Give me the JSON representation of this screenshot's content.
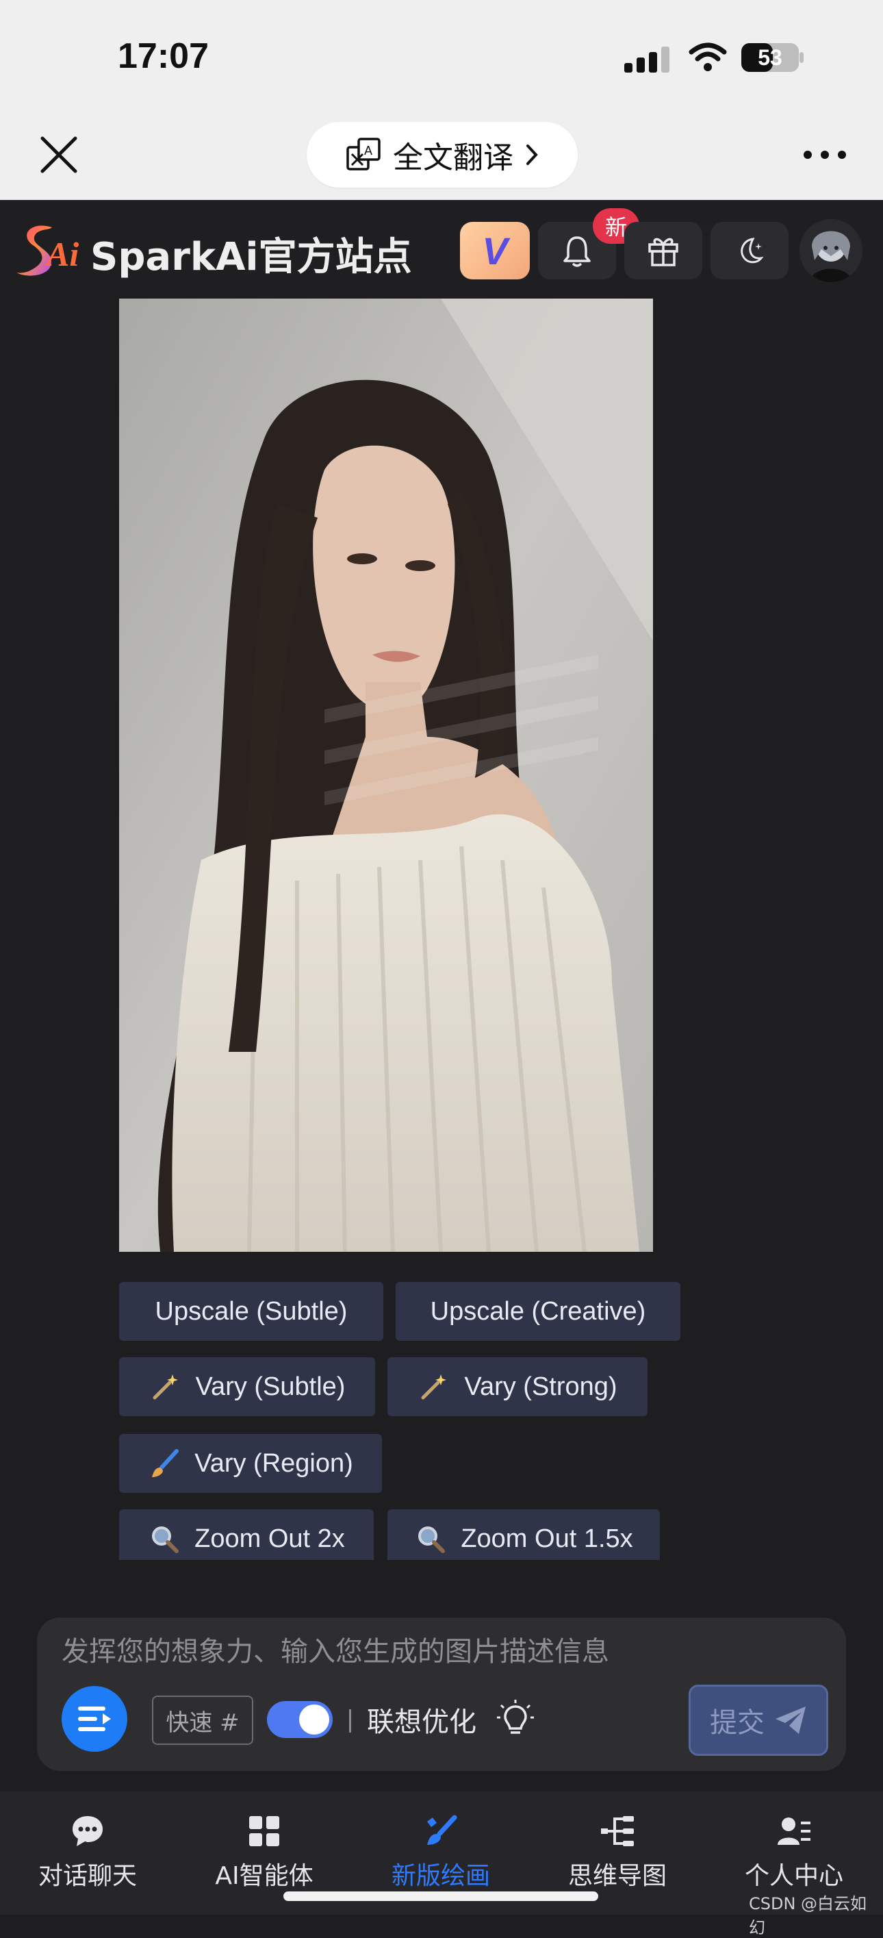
{
  "status": {
    "time": "17:07",
    "battery": "53"
  },
  "browser": {
    "translate_label": "全文翻译"
  },
  "header": {
    "site_title": "SparkAi官方站点",
    "notification_badge": "新",
    "logo_text": "Ai",
    "vip_label": "V"
  },
  "actions": {
    "upscale_subtle": "Upscale (Subtle)",
    "upscale_creative": "Upscale (Creative)",
    "vary_subtle": "Vary (Subtle)",
    "vary_strong": "Vary (Strong)",
    "vary_region": "Vary (Region)",
    "zoom_out_2x": "Zoom Out 2x",
    "zoom_out_1_5x": "Zoom Out 1.5x"
  },
  "composer": {
    "placeholder": "发挥您的想象力、输入您生成的图片描述信息",
    "quick_tag": "快速 #",
    "assoc_label": "联想优化",
    "toggle_on": true,
    "submit_label": "提交"
  },
  "tabs": [
    {
      "label": "对话聊天",
      "icon": "chat-bubble-icon",
      "active": false
    },
    {
      "label": "AI智能体",
      "icon": "grid-apps-icon",
      "active": false
    },
    {
      "label": "新版绘画",
      "icon": "brush-icon",
      "active": true
    },
    {
      "label": "思维导图",
      "icon": "mindmap-icon",
      "active": false
    },
    {
      "label": "个人中心",
      "icon": "user-profile-icon",
      "active": false
    }
  ],
  "watermark": "CSDN @白云如幻",
  "colors": {
    "accent": "#1f7cf7",
    "active_tab": "#2e7bff",
    "badge": "#e3344c",
    "action_bg": "#2f3448"
  }
}
